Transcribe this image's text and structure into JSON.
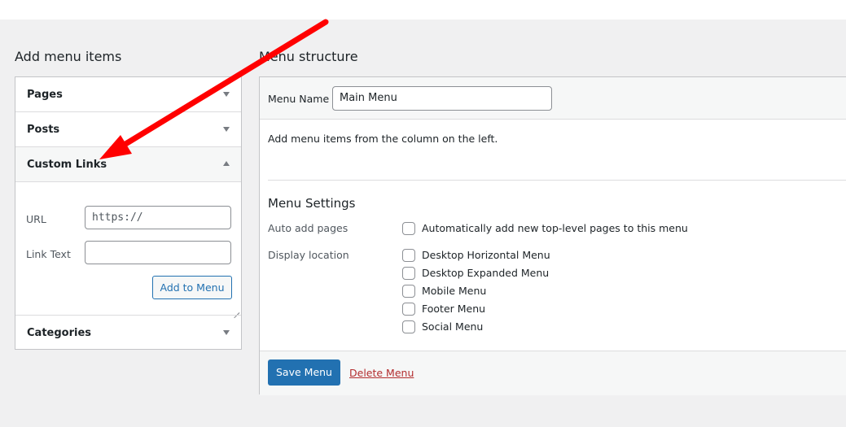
{
  "left_section": {
    "title": "Add menu items",
    "items": [
      {
        "label": "Pages",
        "state": "collapsed"
      },
      {
        "label": "Posts",
        "state": "collapsed"
      },
      {
        "label": "Custom Links",
        "state": "expanded"
      },
      {
        "label": "Categories",
        "state": "collapsed"
      }
    ],
    "custom_links": {
      "url_label": "URL",
      "url_value": "https://",
      "link_text_label": "Link Text",
      "link_text_value": "",
      "add_button": "Add to Menu"
    }
  },
  "right_section": {
    "title": "Menu structure",
    "menu_name_label": "Menu Name",
    "menu_name_value": "Main Menu",
    "helper_text": "Add menu items from the column on the left.",
    "settings": {
      "title": "Menu Settings",
      "auto_add_label": "Auto add pages",
      "auto_add_option": "Automatically add new top-level pages to this menu",
      "display_location_label": "Display location",
      "locations": [
        "Desktop Horizontal Menu",
        "Desktop Expanded Menu",
        "Mobile Menu",
        "Footer Menu",
        "Social Menu"
      ]
    },
    "save_button": "Save Menu",
    "delete_link": "Delete Menu"
  },
  "colors": {
    "primary": "#2271b1",
    "danger": "#b32d2e",
    "annotation_arrow": "#ff0000"
  },
  "icons": {
    "collapsed_arrow": "triangle-down-icon",
    "expanded_arrow": "triangle-up-icon"
  }
}
